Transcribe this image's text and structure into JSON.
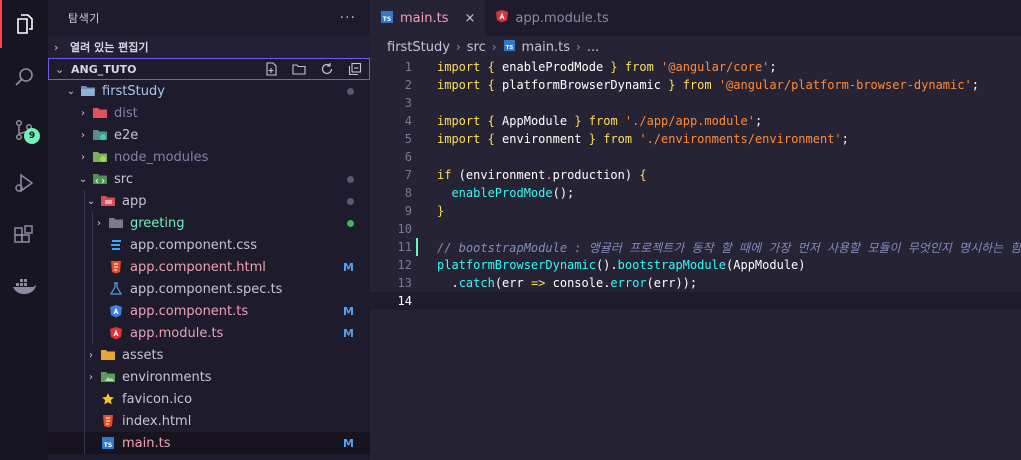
{
  "activity_bar": {
    "scm_badge": "9",
    "icons": [
      "explorer-icon",
      "search-icon",
      "source-control-icon",
      "run-debug-icon",
      "extensions-icon",
      "docker-icon"
    ]
  },
  "sidebar": {
    "title": "탐색기",
    "more": "···",
    "open_editors_label": "열려 있는 편집기",
    "workspace_label": "ANG_TUTO",
    "tree": [
      {
        "label": "firstStudy",
        "status": "",
        "dot": "#5b5878"
      },
      {
        "label": "dist",
        "status": ""
      },
      {
        "label": "e2e",
        "status": ""
      },
      {
        "label": "node_modules",
        "status": ""
      },
      {
        "label": "src",
        "status": "",
        "dot": "#5b5878"
      },
      {
        "label": "app",
        "status": "",
        "dot": "#5b5878"
      },
      {
        "label": "greeting",
        "status": "",
        "dot": "#3fb950"
      },
      {
        "label": "app.component.css",
        "status": ""
      },
      {
        "label": "app.component.html",
        "status": "M"
      },
      {
        "label": "app.component.spec.ts",
        "status": ""
      },
      {
        "label": "app.component.ts",
        "status": "M"
      },
      {
        "label": "app.module.ts",
        "status": "M"
      },
      {
        "label": "assets",
        "status": ""
      },
      {
        "label": "environments",
        "status": ""
      },
      {
        "label": "favicon.ico",
        "status": ""
      },
      {
        "label": "index.html",
        "status": ""
      },
      {
        "label": "main.ts",
        "status": "M"
      }
    ]
  },
  "editor": {
    "tabs": [
      {
        "label": "main.ts",
        "icon": "ts",
        "active": true,
        "close": "×"
      },
      {
        "label": "app.module.ts",
        "icon": "angular",
        "active": false
      }
    ],
    "breadcrumb": [
      "firstStudy",
      "src",
      "main.ts",
      "..."
    ],
    "lines": [
      {
        "n": "1",
        "tokens": [
          [
            "kw",
            "import"
          ],
          [
            "plain",
            " "
          ],
          [
            "brace",
            "{"
          ],
          [
            "plain",
            " enableProdMode "
          ],
          [
            "brace",
            "}"
          ],
          [
            "plain",
            " "
          ],
          [
            "kw",
            "from"
          ],
          [
            "plain",
            " "
          ],
          [
            "str",
            "'@angular/core'"
          ],
          [
            "plain",
            ";"
          ]
        ]
      },
      {
        "n": "2",
        "tokens": [
          [
            "kw",
            "import"
          ],
          [
            "plain",
            " "
          ],
          [
            "brace",
            "{"
          ],
          [
            "plain",
            " platformBrowserDynamic "
          ],
          [
            "brace",
            "}"
          ],
          [
            "plain",
            " "
          ],
          [
            "kw",
            "from"
          ],
          [
            "plain",
            " "
          ],
          [
            "str",
            "'@angular/platform-browser-dynamic'"
          ],
          [
            "plain",
            ";"
          ]
        ]
      },
      {
        "n": "3",
        "tokens": []
      },
      {
        "n": "4",
        "tokens": [
          [
            "kw",
            "import"
          ],
          [
            "plain",
            " "
          ],
          [
            "brace",
            "{"
          ],
          [
            "plain",
            " AppModule "
          ],
          [
            "brace",
            "}"
          ],
          [
            "plain",
            " "
          ],
          [
            "kw",
            "from"
          ],
          [
            "plain",
            " "
          ],
          [
            "str",
            "'./app/app.module'"
          ],
          [
            "plain",
            ";"
          ]
        ]
      },
      {
        "n": "5",
        "tokens": [
          [
            "kw",
            "import"
          ],
          [
            "plain",
            " "
          ],
          [
            "brace",
            "{"
          ],
          [
            "plain",
            " environment "
          ],
          [
            "brace",
            "}"
          ],
          [
            "plain",
            " "
          ],
          [
            "kw",
            "from"
          ],
          [
            "plain",
            " "
          ],
          [
            "str",
            "'./environments/environment'"
          ],
          [
            "plain",
            ";"
          ]
        ]
      },
      {
        "n": "6",
        "tokens": []
      },
      {
        "n": "7",
        "tokens": [
          [
            "kw",
            "if"
          ],
          [
            "plain",
            " ("
          ],
          [
            "plain",
            "environment"
          ],
          [
            "prop",
            "."
          ],
          [
            "plain",
            "production) "
          ],
          [
            "brace",
            "{"
          ]
        ]
      },
      {
        "n": "8",
        "tokens": [
          [
            "plain",
            "  "
          ],
          [
            "fn",
            "enableProdMode"
          ],
          [
            "plain",
            "();"
          ]
        ]
      },
      {
        "n": "9",
        "tokens": [
          [
            "brace",
            "}"
          ]
        ]
      },
      {
        "n": "10",
        "tokens": []
      },
      {
        "n": "11",
        "tokens": [
          [
            "cmt",
            "// bootstrapModule : 앵귤러 프로젝트가 동작 할 때에 가장 먼저 사용할 모듈이 무엇인지 명시하는 함수"
          ]
        ],
        "gutter": true
      },
      {
        "n": "12",
        "tokens": [
          [
            "fn",
            "platformBrowserDynamic"
          ],
          [
            "plain",
            "()."
          ],
          [
            "fn",
            "bootstrapModule"
          ],
          [
            "plain",
            "(AppModule)"
          ]
        ]
      },
      {
        "n": "13",
        "tokens": [
          [
            "plain",
            "  ."
          ],
          [
            "fn",
            "catch"
          ],
          [
            "plain",
            "(err "
          ],
          [
            "kw",
            "=>"
          ],
          [
            "plain",
            " console."
          ],
          [
            "fn",
            "error"
          ],
          [
            "plain",
            "(err));"
          ]
        ]
      },
      {
        "n": "14",
        "tokens": [],
        "current": true
      }
    ]
  }
}
